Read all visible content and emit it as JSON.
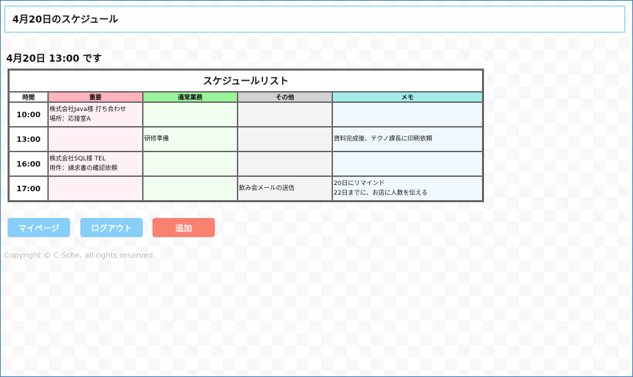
{
  "header": {
    "title": "4月20日のスケジュール"
  },
  "now": "4月20日 13:00 です",
  "table": {
    "caption": "スケジュールリスト",
    "columns": [
      "時間",
      "重要",
      "通常業務",
      "その他",
      "メモ"
    ],
    "rows": [
      {
        "time": "10:00",
        "important": [
          "株式会社Java様 打ち合わせ",
          "場所：応接室A"
        ],
        "normal": [],
        "other": [],
        "memo": []
      },
      {
        "time": "13:00",
        "important": [],
        "normal": [
          "研修準備"
        ],
        "other": [],
        "memo": [
          "資料完成後、テクノ課長に印刷依頼"
        ]
      },
      {
        "time": "16:00",
        "important": [
          "株式会社SQL様 TEL",
          "用件：請求書の確認依頼"
        ],
        "normal": [],
        "other": [],
        "memo": []
      },
      {
        "time": "17:00",
        "important": [],
        "normal": [],
        "other": [
          "飲み会メールの送信"
        ],
        "memo": [
          "20日にリマインド",
          "22日までに、お店に人数を伝える"
        ]
      }
    ]
  },
  "buttons": {
    "mypage": "マイページ",
    "logout": "ログアウト",
    "add": "追加"
  },
  "footer": {
    "copyright": "Copyright © C-Sche, all rights reserved."
  },
  "colors": {
    "header_border": "#a5e0ea",
    "important": "#ffb3bf",
    "normal": "#9af59a",
    "other": "#d3d3d3",
    "memo": "#a3ecec",
    "nav_button": "#87cef8",
    "add_button": "#fa8072"
  }
}
